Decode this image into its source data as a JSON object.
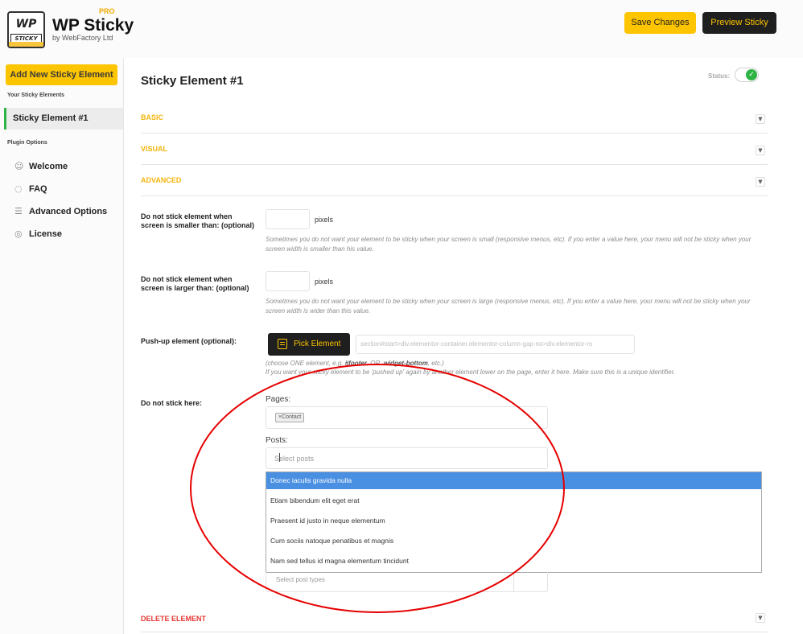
{
  "header": {
    "brand_title": "WP Sticky",
    "brand_pro": "PRO",
    "brand_sub": "by WebFactory Ltd",
    "logo_line1": "WP",
    "logo_line2": "STICKY",
    "save_label": "Save Changes",
    "preview_label": "Preview Sticky"
  },
  "sidebar": {
    "add_label": "Add New Sticky Element",
    "your_elements_caption": "Your Sticky Elements",
    "active_item": "Sticky Element #1",
    "plugin_options_caption": "Plugin Options",
    "items": [
      {
        "label": "Welcome",
        "icon": "handshake-icon"
      },
      {
        "label": "FAQ",
        "icon": "chat-bubble-icon"
      },
      {
        "label": "Advanced Options",
        "icon": "sliders-icon"
      },
      {
        "label": "License",
        "icon": "shield-check-icon"
      }
    ]
  },
  "main": {
    "title": "Sticky Element #1",
    "status_label": "Status:",
    "status_on": true,
    "sections": [
      "BASIC",
      "VISUAL",
      "ADVANCED"
    ],
    "rows": {
      "smaller_label": "Do not stick element when screen is smaller than: (optional)",
      "smaller_unit": "pixels",
      "smaller_help": "Sometimes you do not want your element to be sticky when your screen is small (responsive menus, etc). If you enter a value here, your menu will not be sticky when your screen width is smaller than his value.",
      "larger_label": "Do not stick element when screen is larger than: (optional)",
      "larger_unit": "pixels",
      "larger_help": "Sometimes you do not want your element to be sticky when your screen is large (responsive menus, etc). If you enter a value here, your menu will not be sticky when your screen width is wider than this value.",
      "pushup_label": "Push-up element (optional):",
      "pick_label": "Pick Element",
      "pushup_value": "section#start>div.elementor-container.elementor-column-gap-no>div.elementor-ro",
      "pushup_help_pre": "(choose ONE element, e.g. ",
      "pushup_help_ex1": "#footer",
      "pushup_help_mid": ", OR ",
      "pushup_help_ex2": ".widget-bottom",
      "pushup_help_post": ", etc.)",
      "pushup_help_line2": "If you want your sticky element to be 'pushed up' again by another element lower on the page, enter it here. Make sure this is a unique identifier.",
      "nostick_label": "Do not stick here:",
      "pages_caption": "Pages:",
      "pages_tag": "×Contact",
      "posts_caption": "Posts:",
      "posts_placeholder": "Select posts",
      "types_placeholder": "Select post types"
    },
    "dropdown_options": [
      "Donec iaculis gravida nulla",
      "Etiam bibendum elit eget erat",
      "Praesent id justo in neque elementum",
      "Cum sociis natoque penatibus et magnis",
      "Nam sed tellus id magna elementum tincidunt"
    ],
    "delete_label": "DELETE ELEMENT"
  },
  "colors": {
    "accent": "#fdc400",
    "dark": "#1f1f1f",
    "section_label": "#f3b50b",
    "delete": "#e53935",
    "status_green": "#2fb344",
    "highlight": "#4a90e2",
    "annotation": "#e60000"
  }
}
